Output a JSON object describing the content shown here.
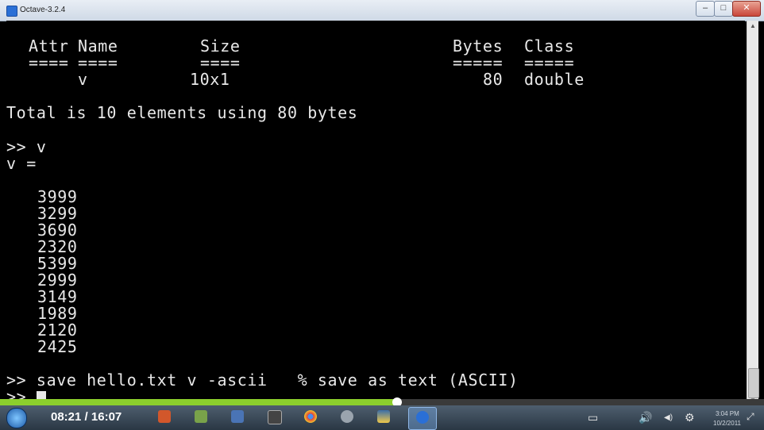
{
  "window": {
    "title": "Octave-3.2.4",
    "buttons": {
      "minimize": "–",
      "maximize": "□",
      "close": "✕"
    }
  },
  "console": {
    "whos_header": {
      "attr": "Attr",
      "name": "Name",
      "size": "Size",
      "bytes": "Bytes",
      "class": "Class",
      "underline_attr": "====",
      "underline_name": "====",
      "underline_size": "====",
      "underline_bytes": "=====",
      "underline_class": "====="
    },
    "whos_row": {
      "attr": "",
      "name": "v",
      "size": "10x1",
      "bytes": "80",
      "class": "double"
    },
    "total_line": "Total is 10 elements using 80 bytes",
    "prompt_cmd_v": ">> v",
    "v_equals": "v =",
    "values": [
      "3999",
      "3299",
      "3690",
      "2320",
      "5399",
      "2999",
      "3149",
      "1989",
      "2120",
      "2425"
    ],
    "save_cmd": ">> save hello.txt v -ascii   % save as text (ASCII)",
    "current_prompt": ">> "
  },
  "video": {
    "elapsed": "08:21",
    "separator": "/",
    "duration": "16:07",
    "progress_fraction": 0.52
  },
  "taskbar": {
    "apps": [
      "start-orb",
      "powerpoint-icon",
      "app-icon",
      "network-icon",
      "camera-icon",
      "chrome-icon",
      "app-icon",
      "python-icon",
      "octave-icon"
    ],
    "tray": {
      "time": "3:04 PM",
      "date": "10/2/2011"
    }
  }
}
